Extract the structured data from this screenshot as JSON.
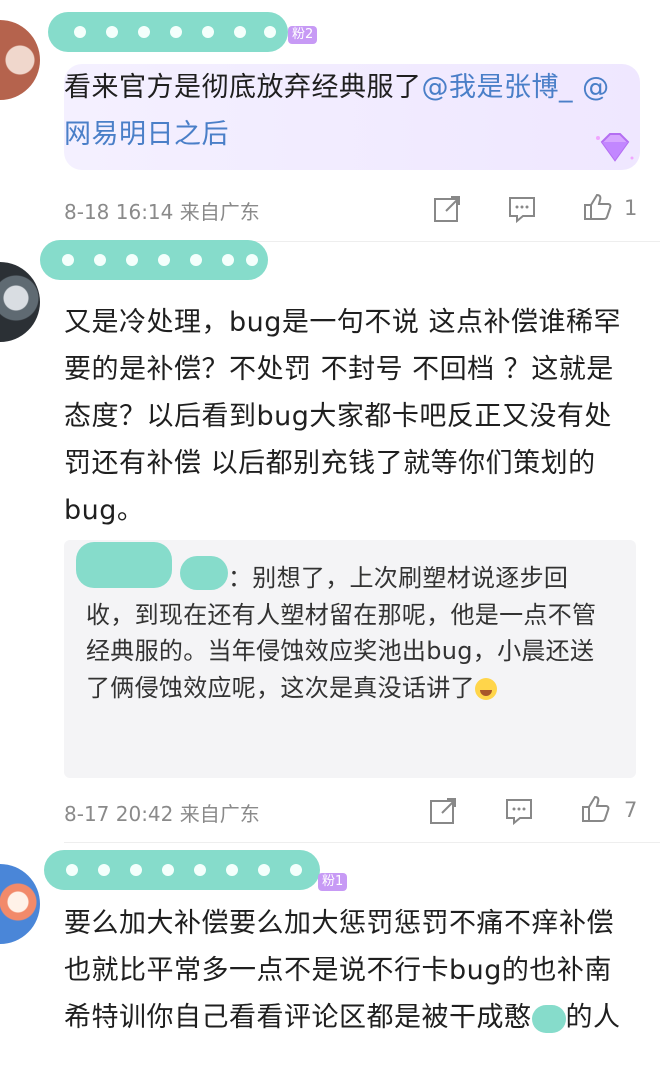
{
  "comments": [
    {
      "badge": "粉2",
      "text_plain": "看来官方是彻底放弃经典服了",
      "mention1": "@我是张博_",
      "mention2": "@网易明日之后",
      "meta": "8-18 16:14 来自广东",
      "likes": "1"
    },
    {
      "text": "又是冷处理，bug是一句不说 这点补偿谁稀罕要的是补偿？不处罚  不封号  不回档  ？这就是态度？以后看到bug大家都卡吧反正又没有处罚还有补偿 以后都别充钱了就等你们策划的bug。",
      "reply": {
        "text": "：别想了，上次刷塑材说逐步回收，到现在还有人塑材留在那呢，他是一点不管经典服的。当年侵蚀效应奖池出bug，小晨还送了俩侵蚀效应呢，这次是真没话讲了",
        "emoji": "laughing-crying-emoji"
      },
      "meta": "8-17 20:42 来自广东",
      "likes": "7"
    },
    {
      "badge": "粉1",
      "text_a": "要么加大补偿要么加大惩罚惩罚不痛不痒补偿也就比平常多一点不是说不行卡bug的也补南希特训你自己看看评论区都是被干成憨",
      "text_b": "的人"
    }
  ],
  "icons": {
    "share": "share-icon",
    "comment": "comment-icon",
    "like": "thumbs-up-icon"
  },
  "colors": {
    "mask": "#86dccb",
    "mention": "#4a7fc8",
    "meta": "#8a8a8a"
  }
}
